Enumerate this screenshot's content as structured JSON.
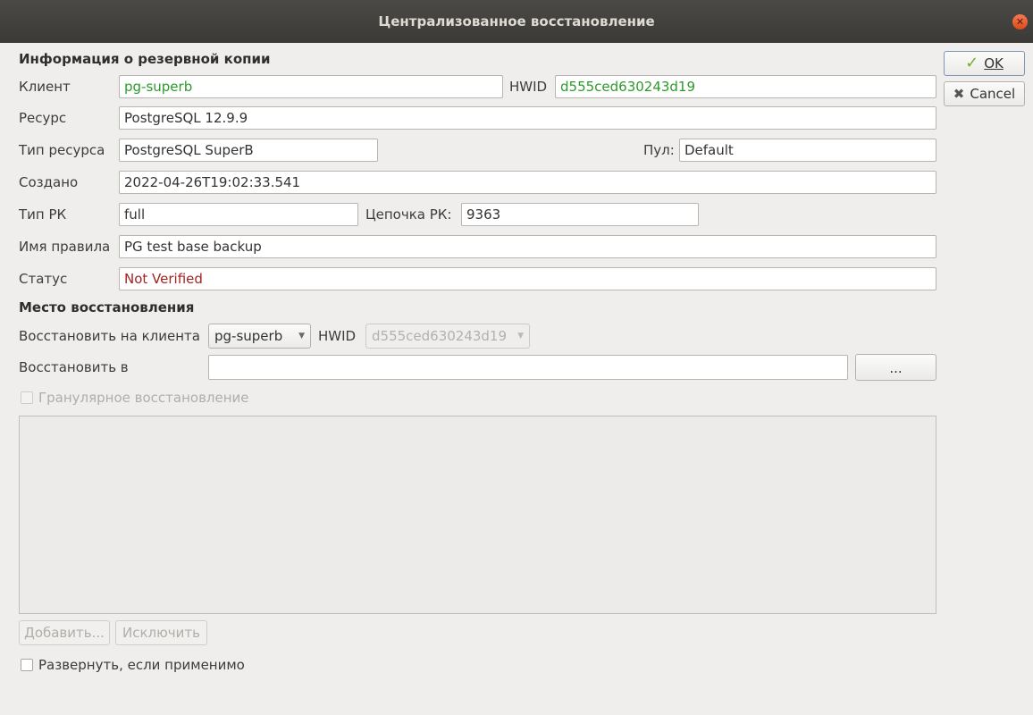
{
  "window": {
    "title": "Централизованное восстановление"
  },
  "buttons": {
    "ok": "OK",
    "cancel": "Cancel",
    "browse": "...",
    "add": "Добавить...",
    "exclude": "Исключить"
  },
  "backup_info": {
    "section_title": "Информация о резервной копии",
    "client_label": "Клиент",
    "client_value": "pg-superb",
    "hwid_label": "HWID",
    "hwid_value": "d555ced630243d19",
    "resource_label": "Ресурс",
    "resource_value": "PostgreSQL 12.9.9",
    "resource_type_label": "Тип ресурса",
    "resource_type_value": "PostgreSQL SuperB",
    "pool_label": "Пул:",
    "pool_value": "Default",
    "created_label": "Создано",
    "created_value": "2022-04-26T19:02:33.541",
    "backup_type_label": "Тип РК",
    "backup_type_value": "full",
    "chain_label": "Цепочка РК:",
    "chain_value": "9363",
    "rule_name_label": "Имя правила",
    "rule_name_value": "PG test base backup",
    "status_label": "Статус",
    "status_value": "Not Verified"
  },
  "restore_location": {
    "section_title": "Место восстановления",
    "restore_to_client_label": "Восстановить на клиента",
    "client_selected": "pg-superb",
    "hwid_label": "HWID",
    "hwid_selected": "d555ced630243d19",
    "restore_to_label": "Восстановить в",
    "restore_to_value": "",
    "granular_label": "Гранулярное восстановление",
    "granular_checked": false,
    "unpack_label": "Развернуть, если применимо",
    "unpack_checked": false
  },
  "colors": {
    "titlebar": "#3c3b37",
    "background": "#efeeed",
    "green_text": "#2c9a2c",
    "status_red": "#a32323"
  }
}
